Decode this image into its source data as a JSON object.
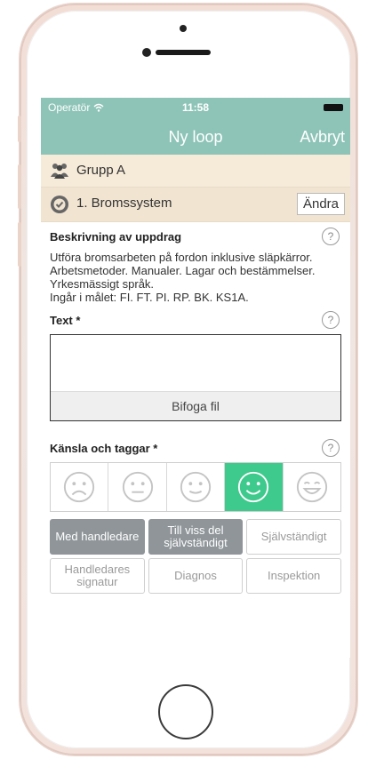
{
  "status": {
    "carrier": "Operatör",
    "time": "11:58"
  },
  "nav": {
    "title": "Ny loop",
    "cancel": "Avbryt"
  },
  "group": {
    "label": "Grupp A"
  },
  "item": {
    "label": "1. Bromssystem",
    "change": "Ändra"
  },
  "description": {
    "heading": "Beskrivning av uppdrag",
    "text": "Utföra bromsarbeten på fordon inklusive släpkärror. Arbetsmetoder. Manualer. Lagar och bestämmelser. Yrkesmässigt språk.",
    "goals": "Ingår i målet: FI. FT. PI. RP. BK. KS1A."
  },
  "text_field": {
    "heading": "Text *",
    "attach": "Bifoga fil"
  },
  "feelings": {
    "heading": "Känsla och taggar *",
    "faces": [
      "very-sad-face-icon",
      "neutral-face-icon",
      "slight-smile-face-icon",
      "smile-face-icon",
      "grin-face-icon"
    ],
    "selected_index": 3
  },
  "tags": [
    {
      "label": "Med handledare",
      "selected": true
    },
    {
      "label": "Till viss del självständigt",
      "selected": true
    },
    {
      "label": "Självständigt",
      "selected": false
    },
    {
      "label": "Handledares signatur",
      "selected": false
    },
    {
      "label": "Diagnos",
      "selected": false
    },
    {
      "label": "Inspektion",
      "selected": false
    }
  ],
  "help_label": "?",
  "colors": {
    "accent": "#8ec4b7",
    "selected_face": "#3ec98d",
    "selected_tag": "#8f9599",
    "row_bg": "#f6ead8"
  }
}
